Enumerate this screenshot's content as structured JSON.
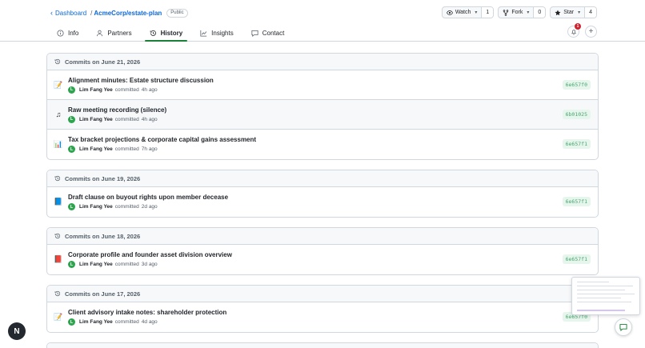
{
  "header": {
    "breadcrumb_dashboard": "Dashboard",
    "breadcrumb_sep": "/",
    "repo_name": "AcmeCorp/estate-plan",
    "visibility_badge": "Public",
    "watch": {
      "label": "Watch",
      "count": "1"
    },
    "fork": {
      "label": "Fork",
      "count": "0"
    },
    "star": {
      "label": "Star",
      "count": "4"
    },
    "notification_count": "1"
  },
  "tabs": [
    {
      "label": "Info",
      "icon": "info-icon"
    },
    {
      "label": "Partners",
      "icon": "person-icon"
    },
    {
      "label": "History",
      "icon": "history-icon",
      "active": true
    },
    {
      "label": "Insights",
      "icon": "graph-icon"
    },
    {
      "label": "Contact",
      "icon": "comment-icon"
    }
  ],
  "commit_groups": [
    {
      "heading": "Commits on June 21, 2026",
      "commits": [
        {
          "icon": "memo-icon",
          "glyph": "📝",
          "title": "Alignment minutes: Estate structure discussion",
          "author": "Lim Fang Yee",
          "avatar": "L",
          "verb": "committed",
          "age": "4h ago",
          "sha": "6e657f0"
        },
        {
          "icon": "music-note-icon",
          "glyph": "♫",
          "title": "Raw meeting recording (silence)",
          "author": "Lim Fang Yee",
          "avatar": "L",
          "verb": "committed",
          "age": "4h ago",
          "sha": "6b01025"
        },
        {
          "icon": "bar-chart-icon",
          "glyph": "📊",
          "title": "Tax bracket projections & corporate capital gains assessment",
          "author": "Lim Fang Yee",
          "avatar": "L",
          "verb": "committed",
          "age": "7h ago",
          "sha": "6e657f1"
        }
      ]
    },
    {
      "heading": "Commits on June 19, 2026",
      "commits": [
        {
          "icon": "blue-book-icon",
          "glyph": "📘",
          "title": "Draft clause on buyout rights upon member decease",
          "author": "Lim Fang Yee",
          "avatar": "L",
          "verb": "committed",
          "age": "2d ago",
          "sha": "6e657f1"
        }
      ]
    },
    {
      "heading": "Commits on June 18, 2026",
      "commits": [
        {
          "icon": "red-book-icon",
          "glyph": "📕",
          "title": "Corporate profile and founder asset division overview",
          "author": "Lim Fang Yee",
          "avatar": "L",
          "verb": "committed",
          "age": "3d ago",
          "sha": "6e657f1"
        }
      ]
    },
    {
      "heading": "Commits on June 17, 2026",
      "commits": [
        {
          "icon": "memo-icon",
          "glyph": "📝",
          "title": "Client advisory intake notes: shareholder protection",
          "author": "Lim Fang Yee",
          "avatar": "L",
          "verb": "committed",
          "age": "4d ago",
          "sha": "6e657f0"
        }
      ]
    }
  ],
  "fab_left_label": "N",
  "colors": {
    "accent": "#0969da",
    "active_tab": "#1a7f37",
    "avatar": "#2da44e",
    "sha_bg": "#e6f6ed"
  }
}
